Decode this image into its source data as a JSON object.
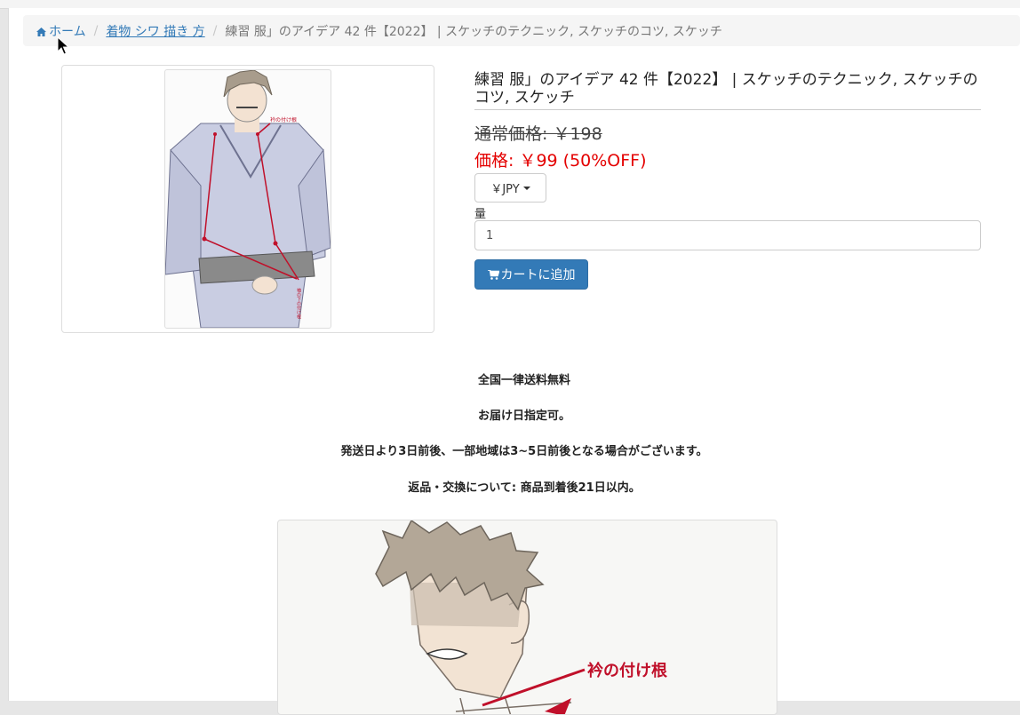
{
  "breadcrumb": {
    "home": "ホーム",
    "category": "着物 シワ 描き 方",
    "current": "練習 服」のアイデア 42 件【2022】 | スケッチのテクニック, スケッチのコツ, スケッチ"
  },
  "product": {
    "title": "練習 服」のアイデア 42 件【2022】 | スケッチのテクニック, スケッチのコツ, スケッチ",
    "regular_price": "通常価格: ￥198",
    "sale_price": "価格: ￥99 (50%OFF)",
    "currency": "￥JPY",
    "quantity_label": "量",
    "quantity_value": "1",
    "add_to_cart": "カートに追加"
  },
  "thumbnail_labels": {
    "collar_root": "衿の付け根",
    "sleeve_root": "袖の下の付け根"
  },
  "description": [
    "全国一律送料無料",
    "お届け日指定可。",
    "発送日より3日前後、一部地域は3~5日前後となる場合がございます。",
    "返品・交換について: 商品到着後21日以内。"
  ],
  "large_image_label": "衿の付け根",
  "colors": {
    "link": "#337ab7",
    "sale": "#e40000",
    "annotation_red": "#c0102a"
  }
}
